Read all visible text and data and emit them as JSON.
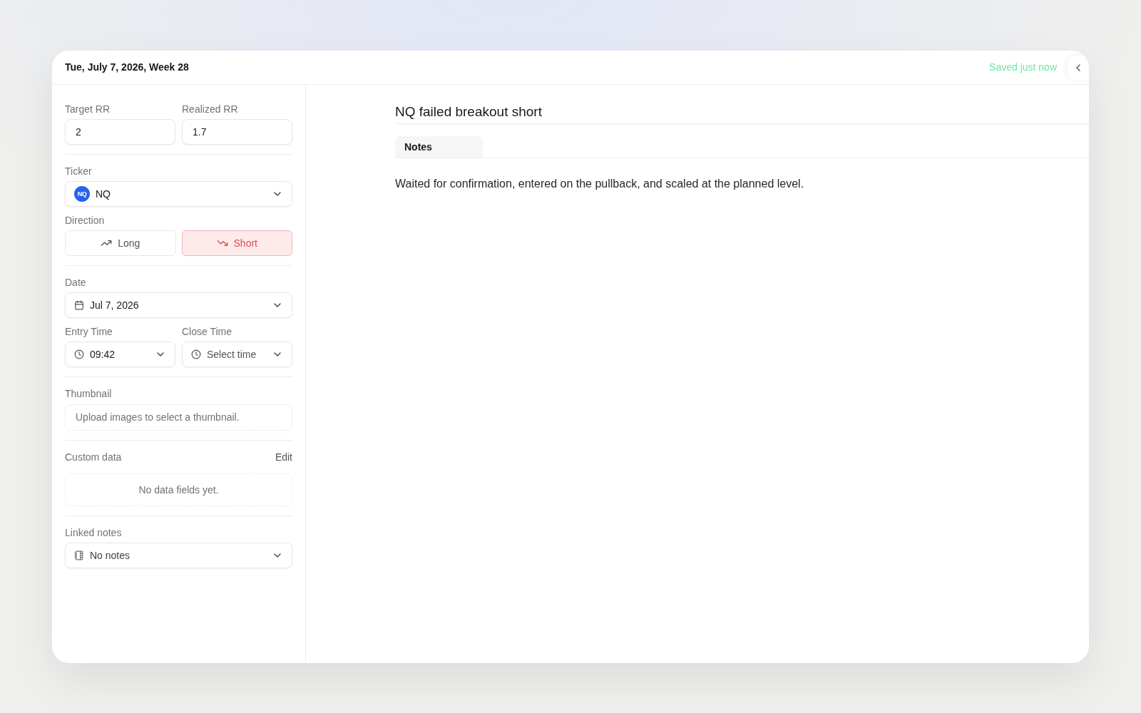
{
  "header": {
    "date": "Tue, July 7, 2026, Week 28",
    "save_status": "Saved just now"
  },
  "sidebar": {
    "rr_fields": [
      {
        "label": "Target RR",
        "value": "2"
      },
      {
        "label": "Realized RR",
        "value": "1.7"
      }
    ],
    "ticker": {
      "label": "Ticker",
      "logo": "NQ",
      "value": "NQ"
    },
    "direction": {
      "label": "Direction",
      "options": [
        {
          "label": "Long",
          "kind": "long",
          "selected": false
        },
        {
          "label": "Short",
          "kind": "short",
          "selected": true
        }
      ]
    },
    "date": {
      "label": "Date",
      "value": "Jul 7, 2026"
    },
    "times": [
      {
        "label": "Entry Time",
        "value": "09:42"
      },
      {
        "label": "Close Time",
        "placeholder": "Select time"
      }
    ],
    "thumbnail": {
      "label": "Thumbnail",
      "message": "Upload images to select a thumbnail."
    },
    "custom_data": {
      "label": "Custom data",
      "action": "Edit",
      "empty_message": "No data fields yet."
    },
    "linked_notes": {
      "label": "Linked notes",
      "value": "No notes"
    }
  },
  "editor": {
    "title": "NQ failed breakout short",
    "tabs": [
      {
        "label": "Notes",
        "selected": true
      }
    ],
    "body": "Waited for confirmation, entered on the pullback, and scaled at the planned level."
  }
}
